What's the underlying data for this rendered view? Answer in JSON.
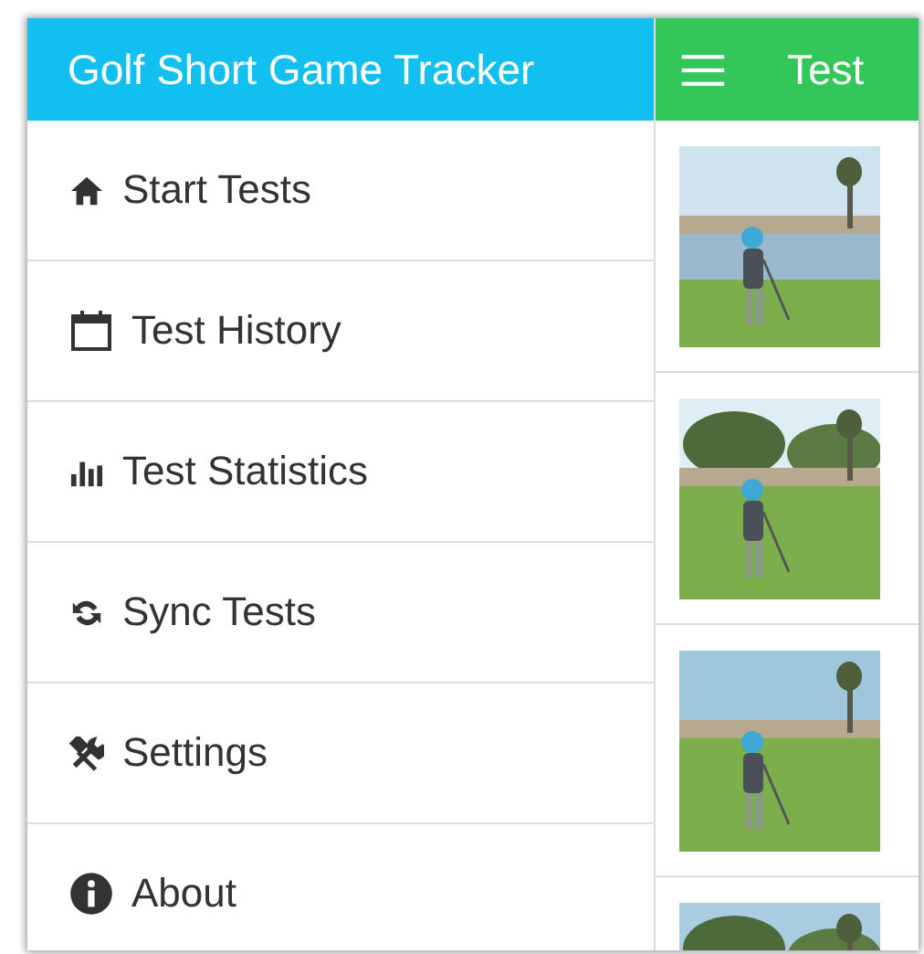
{
  "drawer": {
    "title": "Golf Short Game Tracker",
    "items": [
      {
        "label": "Start Tests"
      },
      {
        "label": "Test History"
      },
      {
        "label": "Test Statistics"
      },
      {
        "label": "Sync Tests"
      },
      {
        "label": "Settings"
      },
      {
        "label": "About"
      }
    ]
  },
  "main": {
    "title": "Test"
  }
}
